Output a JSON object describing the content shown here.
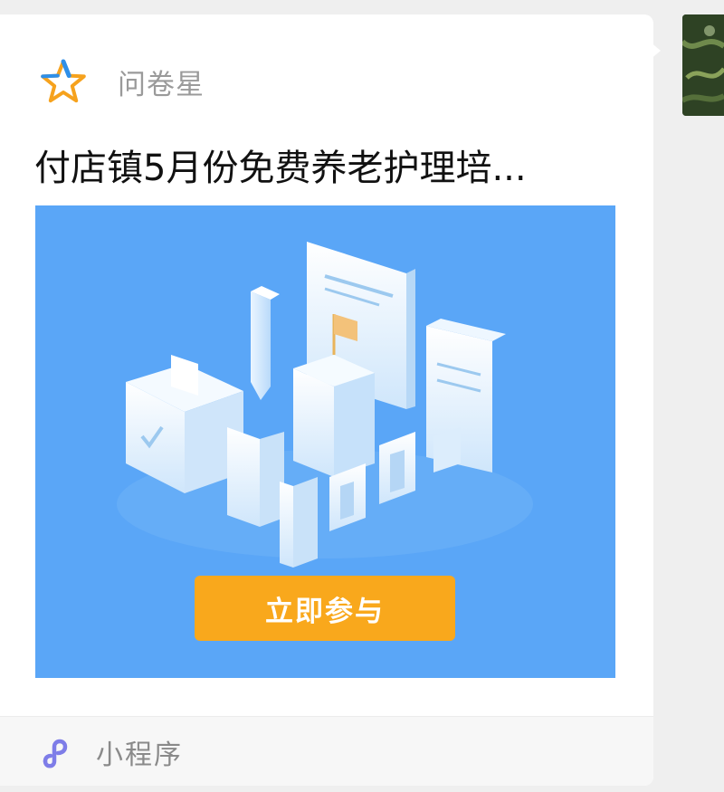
{
  "card": {
    "app_name": "问卷星",
    "app_icon": "star-icon",
    "title": "付店镇5月份免费养老护理培...",
    "banner": {
      "illustration": "isometric-buildings-illustration",
      "cta_label": "立即参与"
    },
    "footer": {
      "icon": "mini-program-icon",
      "label": "小程序"
    }
  },
  "sender": {
    "avatar": "avatar"
  },
  "colors": {
    "banner_bg": "#5aa6f7",
    "cta_bg": "#f9a81c",
    "star_orange": "#f6a21d",
    "star_blue": "#2f8fe8",
    "mini_program_purple": "#7e7de8"
  }
}
